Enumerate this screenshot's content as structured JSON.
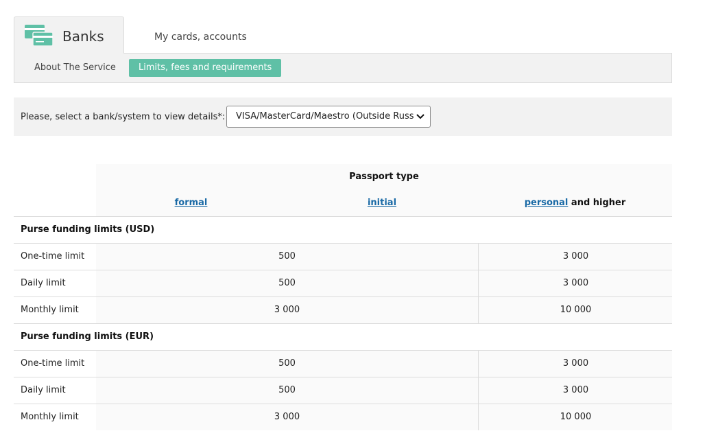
{
  "tabs": {
    "active_label": "Banks",
    "inactive_label": "My cards, accounts"
  },
  "subnav": {
    "about_label": "About The Service",
    "limits_label": "Limits, fees and requirements"
  },
  "selector": {
    "prompt": "Please, select a bank/system to view details*:",
    "selected_value": "VISA/MasterCard/Maestro (Outside Russia"
  },
  "table": {
    "passport_title": "Passport type",
    "columns": {
      "formal": "formal",
      "initial": "initial",
      "personal": "personal",
      "personal_suffix": "and higher"
    },
    "sections": [
      {
        "title": "Purse funding limits (USD)",
        "rows": [
          {
            "label": "One-time limit",
            "v1": "500",
            "v2": "3 000"
          },
          {
            "label": "Daily limit",
            "v1": "500",
            "v2": "3 000"
          },
          {
            "label": "Monthly limit",
            "v1": "3 000",
            "v2": "10 000"
          }
        ]
      },
      {
        "title": "Purse funding limits (EUR)",
        "rows": [
          {
            "label": "One-time limit",
            "v1": "500",
            "v2": "3 000"
          },
          {
            "label": "Daily limit",
            "v1": "500",
            "v2": "3 000"
          },
          {
            "label": "Monthly limit",
            "v1": "3 000",
            "v2": "10 000"
          }
        ]
      }
    ]
  },
  "colors": {
    "accent": "#5fc0a6",
    "link": "#1a6aa6",
    "panel_bg": "#f2f2f2"
  },
  "icons": {
    "bank_tab_icon": "bank-cards-icon",
    "dropdown_icon": "chevron-down-icon"
  }
}
